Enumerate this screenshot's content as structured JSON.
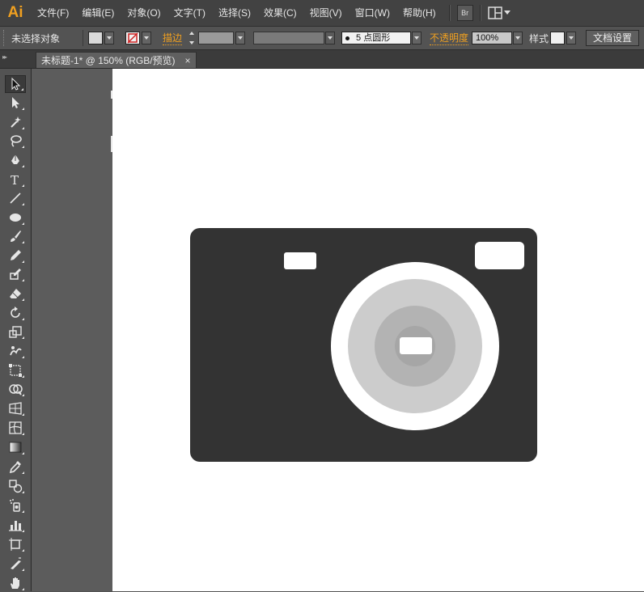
{
  "app": {
    "logo": "Ai",
    "accent": "#f0a020"
  },
  "menu": [
    "文件(F)",
    "编辑(E)",
    "对象(O)",
    "文字(T)",
    "选择(S)",
    "效果(C)",
    "视图(V)",
    "窗口(W)",
    "帮助(H)"
  ],
  "menubar_buttons": {
    "bridge": "Br",
    "arrange_icon": "workspace-layout-icon"
  },
  "control_bar": {
    "selection_status": "未选择对象",
    "stroke_label": "描边",
    "brush_value": "5 点圆形",
    "opacity_label": "不透明度",
    "opacity_value": "100%",
    "style_label": "样式",
    "document_setup": "文档设置"
  },
  "document_tab": {
    "title": "未标题-1* @ 150% (RGB/预览)",
    "close": "×"
  },
  "tools": [
    "selection-tool-icon",
    "direct-selection-tool-icon",
    "magic-wand-tool-icon",
    "lasso-tool-icon",
    "pen-tool-icon",
    "type-tool-icon",
    "line-tool-icon",
    "ellipse-tool-icon",
    "paintbrush-tool-icon",
    "pencil-tool-icon",
    "blob-brush-tool-icon",
    "eraser-tool-icon",
    "rotate-tool-icon",
    "scale-tool-icon",
    "warp-tool-icon",
    "free-transform-tool-icon",
    "shape-builder-tool-icon",
    "perspective-grid-tool-icon",
    "mesh-tool-icon",
    "gradient-tool-icon",
    "eyedropper-tool-icon",
    "blend-tool-icon",
    "symbol-sprayer-tool-icon",
    "column-graph-tool-icon",
    "artboard-tool-icon",
    "slice-tool-icon",
    "hand-tool-icon"
  ],
  "artwork": {
    "name": "camera-icon",
    "colors": {
      "body": "#333333",
      "windows": "#ffffff",
      "lens_ring_outer": "#ffffff",
      "lens_ring_mid": "#cccccc",
      "lens_ring_inner": "#b3b3b3",
      "lens_core": "#a6a6a6",
      "lens_highlight": "#ffffff"
    }
  }
}
